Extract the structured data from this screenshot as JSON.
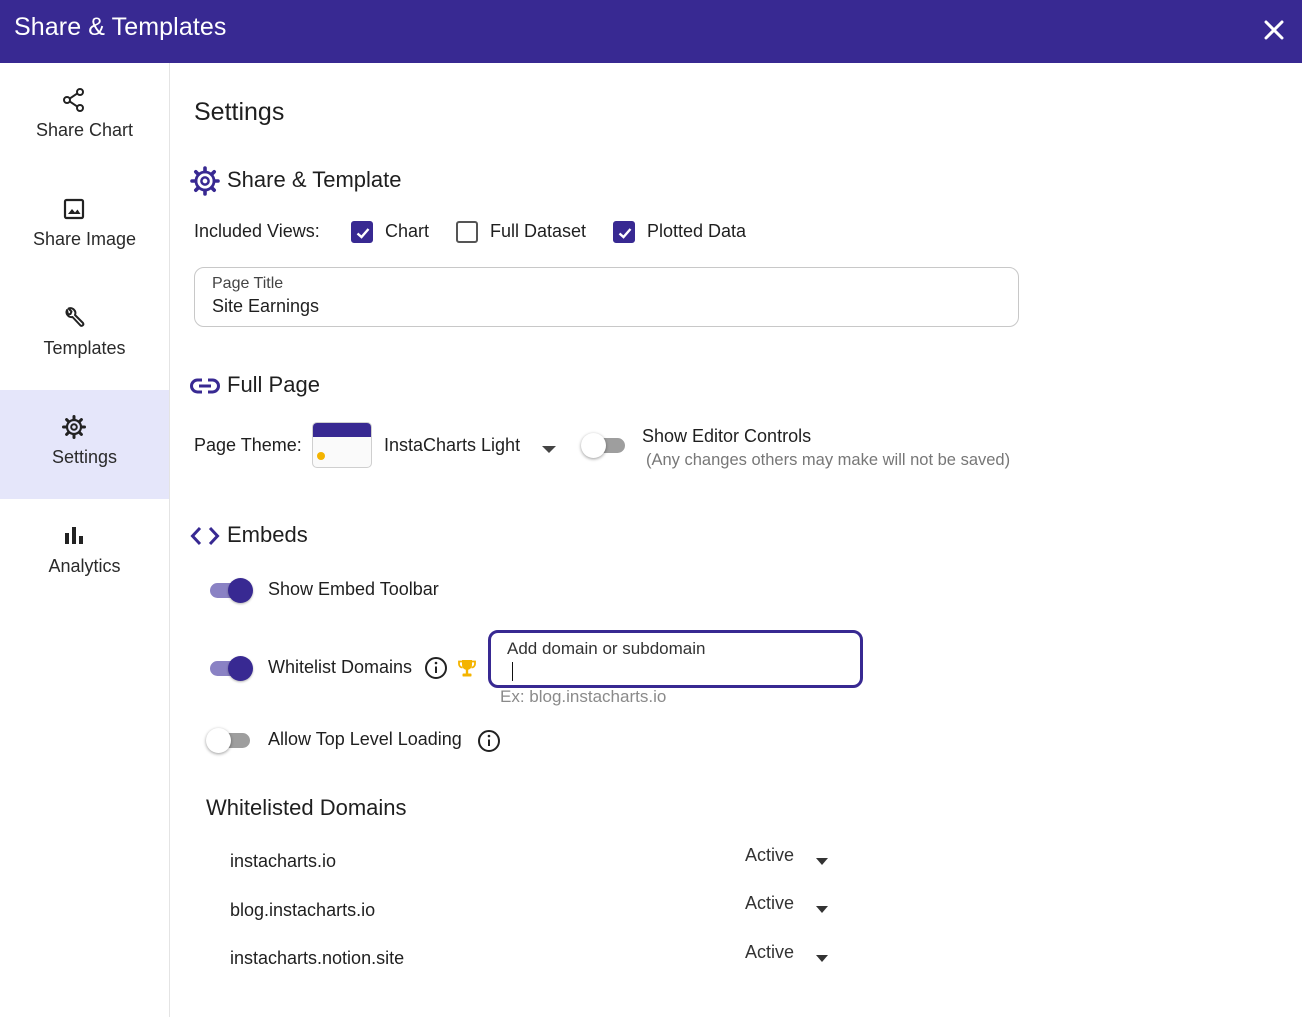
{
  "header": {
    "title": "Share & Templates",
    "close_icon": "close-icon"
  },
  "sidebar": {
    "items": [
      {
        "label": "Share Chart",
        "icon": "share-icon"
      },
      {
        "label": "Share Image",
        "icon": "image-icon"
      },
      {
        "label": "Templates",
        "icon": "wrench-icon"
      },
      {
        "label": "Settings",
        "icon": "gear-icon",
        "active": true
      },
      {
        "label": "Analytics",
        "icon": "bar-chart-icon"
      }
    ]
  },
  "main": {
    "title": "Settings",
    "share_template": {
      "heading": "Share & Template",
      "included_views_label": "Included Views:",
      "views": [
        {
          "label": "Chart",
          "checked": true
        },
        {
          "label": "Full Dataset",
          "checked": false
        },
        {
          "label": "Plotted Data",
          "checked": true
        }
      ],
      "page_title_label": "Page Title",
      "page_title_value": "Site Earnings"
    },
    "full_page": {
      "heading": "Full Page",
      "page_theme_label": "Page Theme:",
      "page_theme_value": "InstaCharts Light",
      "show_editor_controls_label": "Show Editor Controls",
      "show_editor_controls_note": "(Any changes others may make will not be saved)",
      "show_editor_controls_on": false
    },
    "embeds": {
      "heading": "Embeds",
      "show_embed_toolbar_label": "Show Embed Toolbar",
      "show_embed_toolbar_on": true,
      "whitelist_domains_label": "Whitelist Domains",
      "whitelist_domains_on": true,
      "domain_input_placeholder": "Add domain or subdomain",
      "domain_input_helper": "Ex: blog.instacharts.io",
      "allow_top_level_loading_label": "Allow Top Level Loading",
      "allow_top_level_loading_on": false
    },
    "whitelisted": {
      "heading": "Whitelisted Domains",
      "rows": [
        {
          "domain": "instacharts.io",
          "status": "Active"
        },
        {
          "domain": "blog.instacharts.io",
          "status": "Active"
        },
        {
          "domain": "instacharts.notion.site",
          "status": "Active"
        }
      ]
    }
  },
  "colors": {
    "primary": "#382992",
    "active_nav_bg": "#e5e6fa",
    "trophy": "#f4b400"
  }
}
